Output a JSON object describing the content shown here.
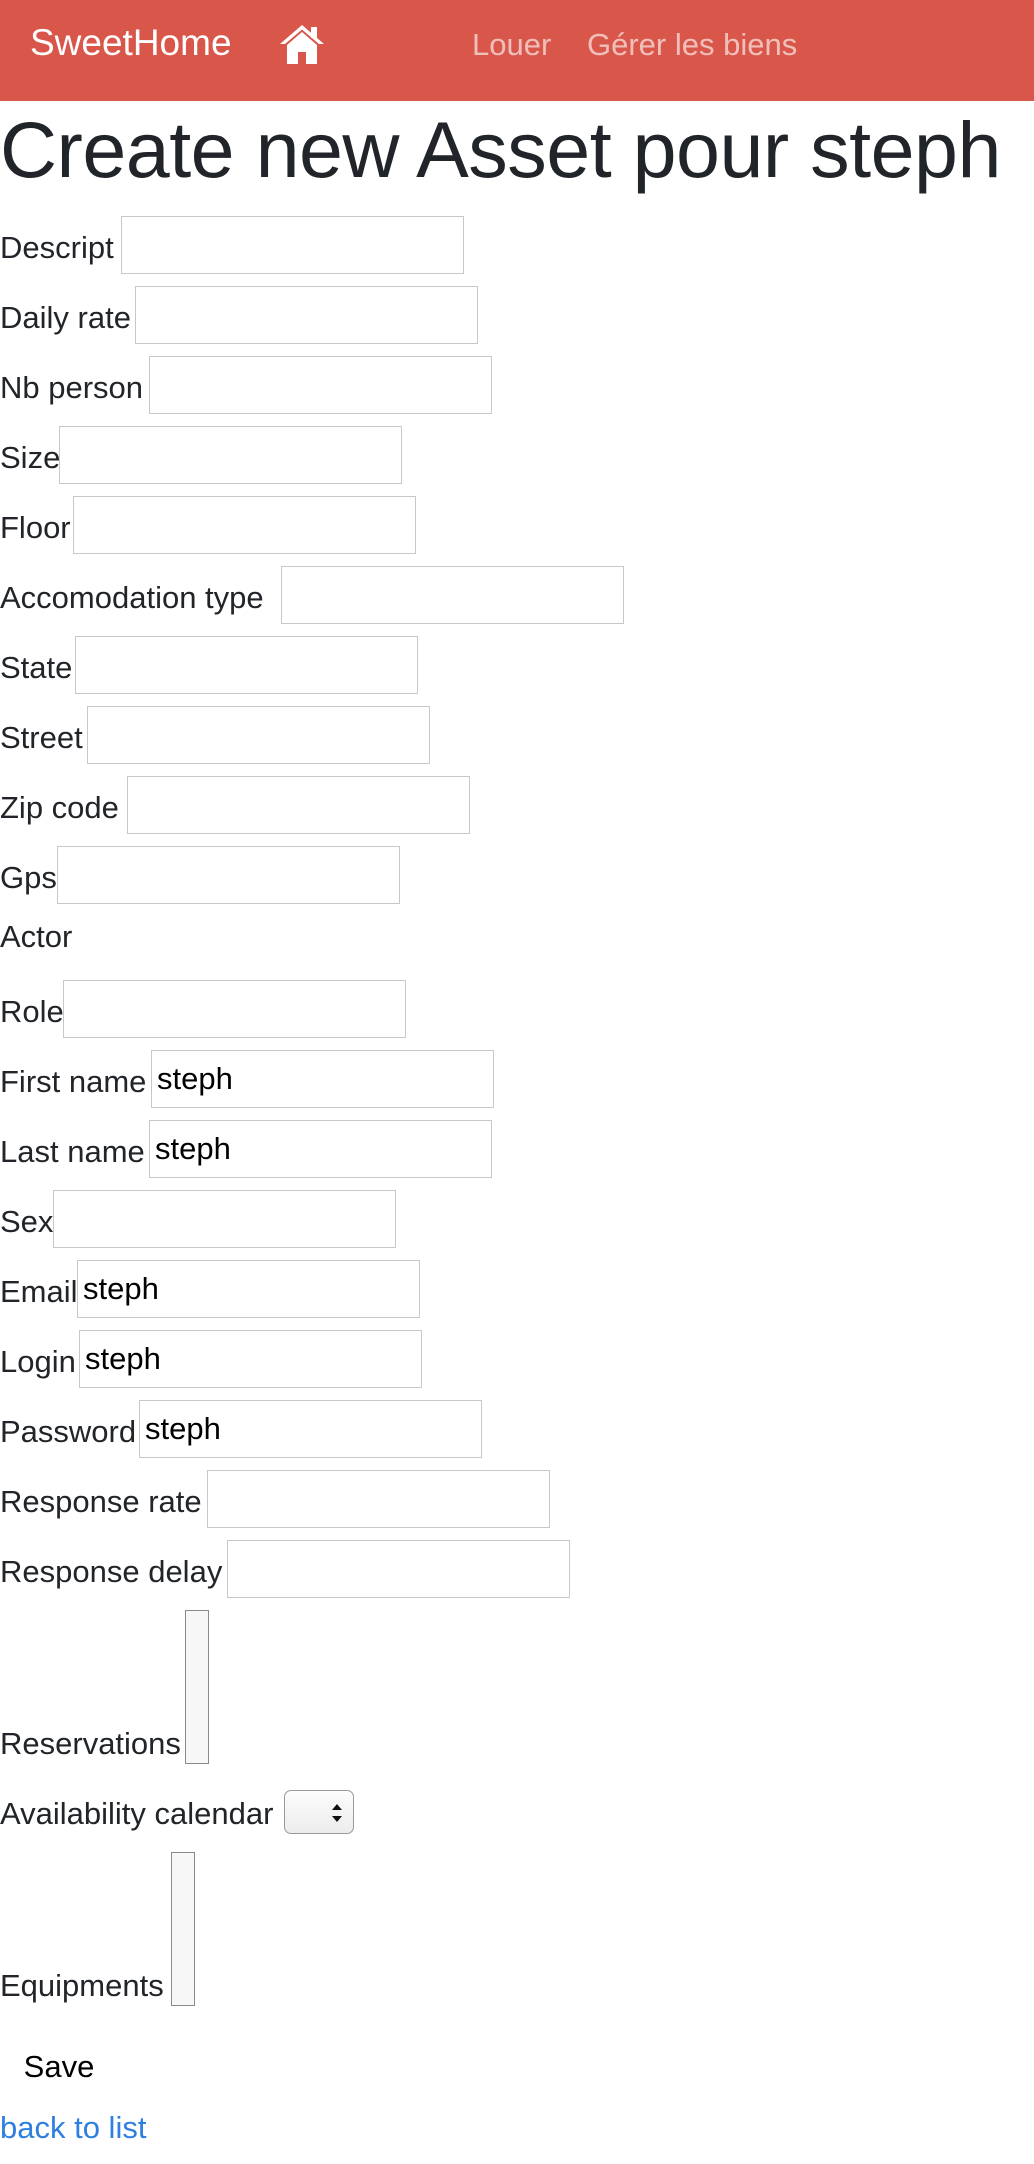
{
  "navbar": {
    "brand": "SweetHome",
    "home_icon": "home-icon",
    "links": [
      "Louer",
      "Gérer les biens"
    ],
    "background_color": "#d9574a"
  },
  "page": {
    "title": "Create new Asset pour steph"
  },
  "fields": [
    {
      "label": "Descript",
      "value": ""
    },
    {
      "label": "Daily rate",
      "value": ""
    },
    {
      "label": "Nb person",
      "value": ""
    },
    {
      "label": "Size",
      "value": ""
    },
    {
      "label": "Floor",
      "value": ""
    },
    {
      "label": "Accomodation type",
      "value": ""
    },
    {
      "label": "State",
      "value": ""
    },
    {
      "label": "Street",
      "value": ""
    },
    {
      "label": "Zip code",
      "value": ""
    },
    {
      "label": "Gps",
      "value": ""
    }
  ],
  "actor": {
    "section_label": "Actor",
    "fields": [
      {
        "label": "Role",
        "value": ""
      },
      {
        "label": "First name",
        "value": "steph"
      },
      {
        "label": "Last name",
        "value": "steph"
      },
      {
        "label": "Sex",
        "value": ""
      },
      {
        "label": "Email",
        "value": "steph"
      },
      {
        "label": "Login",
        "value": "steph"
      },
      {
        "label": "Password",
        "value": "steph"
      },
      {
        "label": "Response rate",
        "value": ""
      },
      {
        "label": "Response delay",
        "value": ""
      }
    ]
  },
  "reservations": {
    "label": "Reservations"
  },
  "availability_calendar": {
    "label": "Availability calendar",
    "selected": ""
  },
  "equipments": {
    "label": "Equipments"
  },
  "actions": {
    "save_label": "Save",
    "back_label": "back to list",
    "link_color": "#2e7fe0"
  }
}
